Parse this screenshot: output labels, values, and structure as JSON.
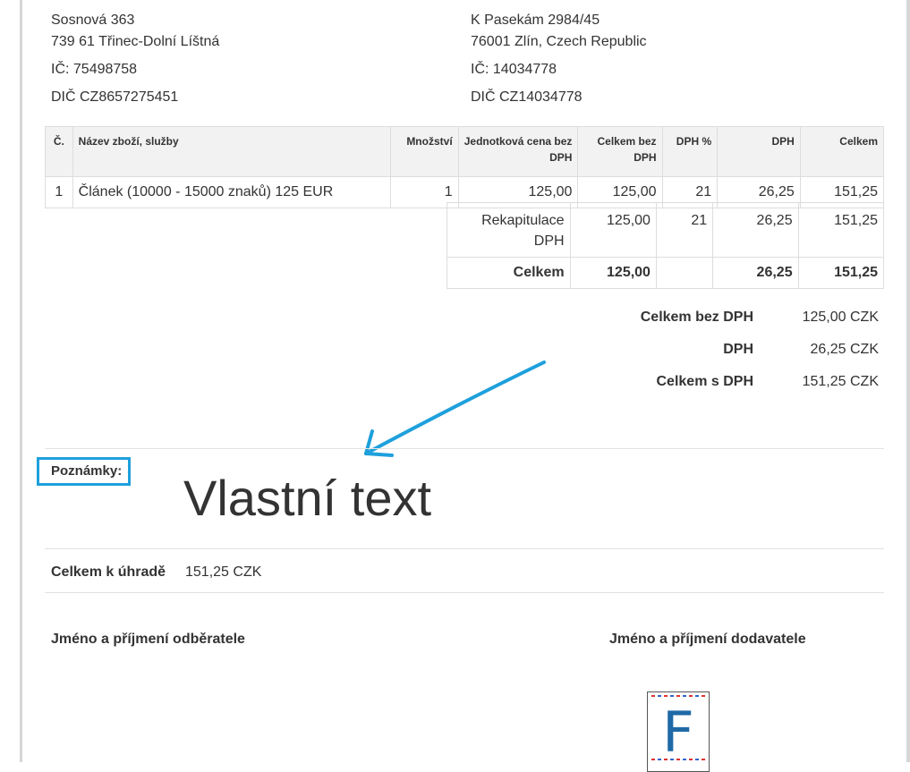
{
  "supplier": {
    "street": "Sosnová 363",
    "city": "739 61 Třinec-Dolní Líštná",
    "ic": "IČ: 75498758",
    "dic": "DIČ CZ8657275451"
  },
  "customer": {
    "street": "K Pasekám 2984/45",
    "city": "76001 Zlín, Czech Republic",
    "ic": "IČ: 14034778",
    "dic": "DIČ CZ14034778"
  },
  "items_table": {
    "headers": [
      "Č.",
      "Název zboží, služby",
      "Množství",
      "Jednotková cena bez DPH",
      "Celkem bez DPH",
      "DPH %",
      "DPH",
      "Celkem"
    ],
    "rows": [
      [
        "1",
        "Článek (10000 - 15000 znaků) 125 EUR",
        "1",
        "125,00",
        "125,00",
        "21",
        "26,25",
        "151,25"
      ]
    ]
  },
  "recap": {
    "label": "Rekapitulace DPH",
    "base": "125,00",
    "rate": "21",
    "vat": "26,25",
    "total": "151,25",
    "total_label": "Celkem",
    "total_base": "125,00",
    "total_vat": "26,25",
    "total_sum": "151,25"
  },
  "summary": [
    {
      "label": "Celkem bez DPH",
      "value": "125,00 CZK"
    },
    {
      "label": "DPH",
      "value": "26,25 CZK"
    },
    {
      "label": "Celkem s DPH",
      "value": "151,25 CZK"
    }
  ],
  "notes": {
    "label": "Poznámky:",
    "text": "Vlastní text",
    "highlight_color": "#1ea0dc",
    "arrow_color": "#1ea0dc"
  },
  "payable": {
    "label": "Celkem k úhradě",
    "value": "151,25 CZK"
  },
  "signatures": {
    "customer": "Jméno a příjmení odběratele",
    "supplier": "Jméno a příjmení dodavatele"
  },
  "logo": {
    "letter": "F",
    "icon": "fakturoid-logo-icon"
  }
}
